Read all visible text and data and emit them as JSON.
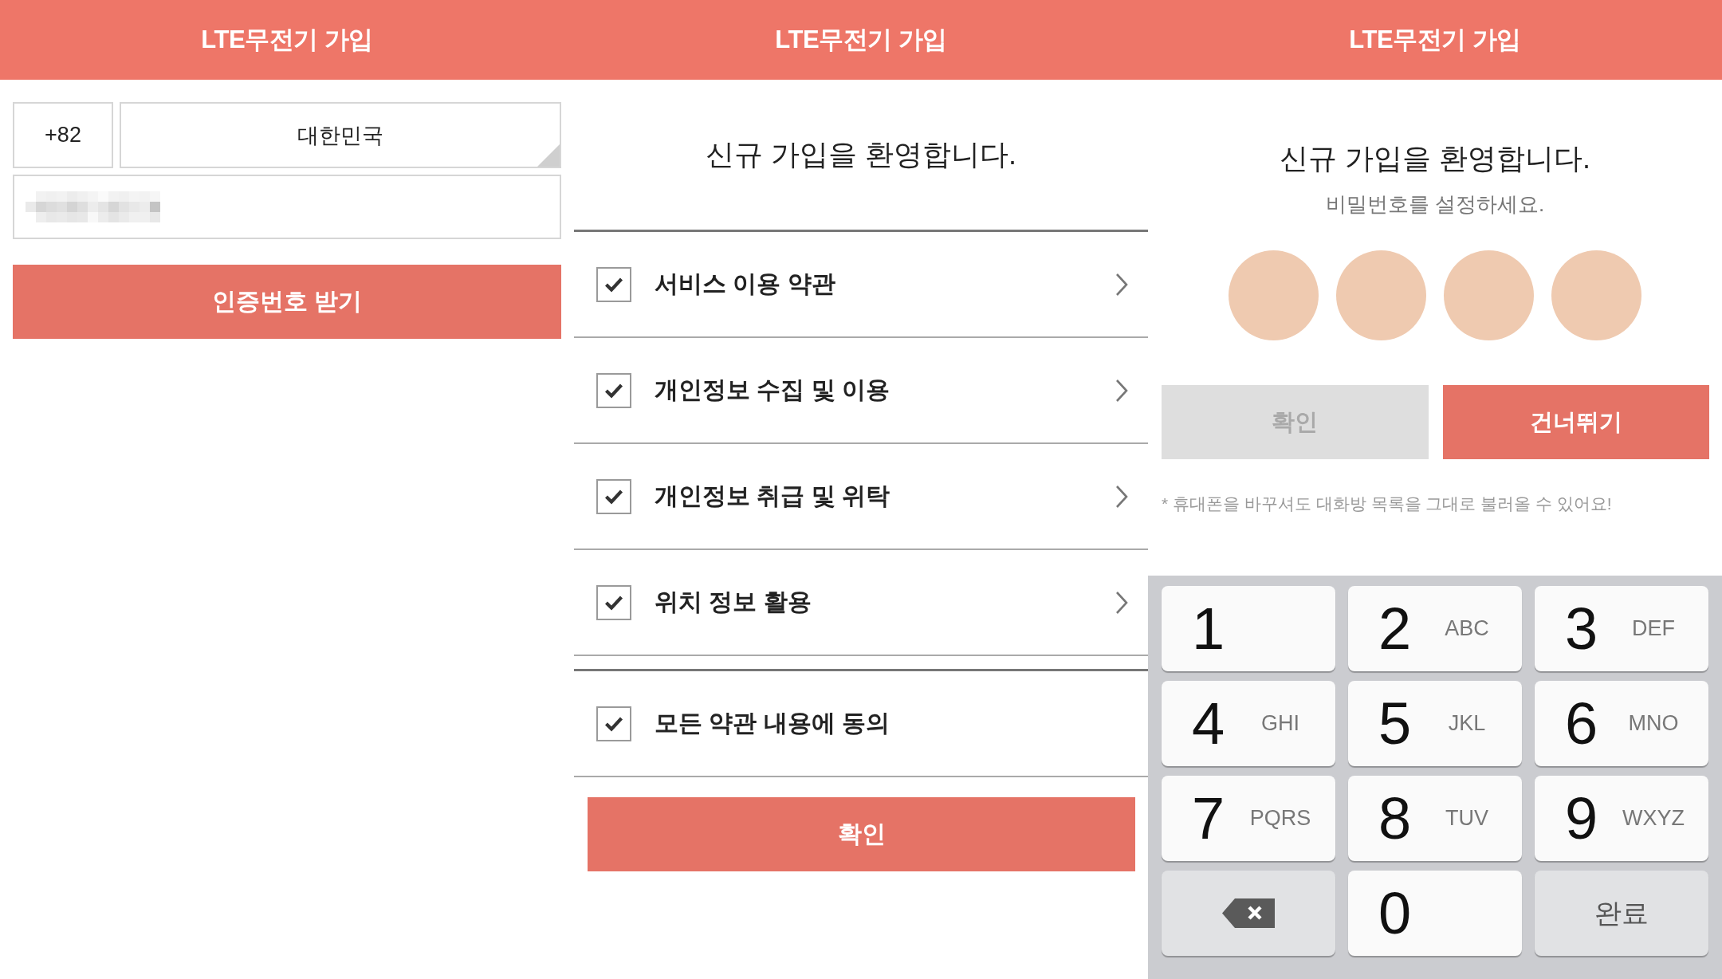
{
  "panels": [
    {
      "kind": "phone",
      "header": {
        "title": "LTE무전기 가입"
      },
      "country_code": "+82",
      "country": "대한민국",
      "phone_field": {
        "value_pixelated": true
      },
      "button": "인증번호 받기"
    },
    {
      "kind": "terms",
      "header": {
        "title": "LTE무전기 가입"
      },
      "welcome": "신규 가입을 환영합니다.",
      "terms": [
        {
          "label": "서비스 이용 약관",
          "checked": true
        },
        {
          "label": "개인정보 수집 및 이용",
          "checked": true
        },
        {
          "label": "개인정보 취급 및 위탁",
          "checked": true
        },
        {
          "label": "위치 정보 활용",
          "checked": true
        }
      ],
      "agree_all": {
        "label": "모든 약관 내용에 동의",
        "checked": true
      },
      "button": "확인"
    },
    {
      "kind": "password",
      "header": {
        "title": "LTE무전기 가입"
      },
      "welcome": "신규 가입을 환영합니다.",
      "subtitle": "비밀번호를 설정하세요.",
      "pin_dots": [
        {
          "filled": false
        },
        {
          "filled": false
        },
        {
          "filled": false
        },
        {
          "filled": false
        }
      ],
      "buttons": [
        {
          "label": "확인",
          "disabled": true
        },
        {
          "label": "건너뛰기",
          "disabled": false
        }
      ],
      "note": "* 휴대폰을 바꾸셔도 대화방 목록을 그대로 불러올 수 있어요!",
      "keypad": {
        "keys": [
          {
            "kind": "digit",
            "digit": "1"
          },
          {
            "kind": "digit",
            "digit": "2",
            "letters": "ABC"
          },
          {
            "kind": "digit",
            "digit": "3",
            "letters": "DEF"
          },
          {
            "kind": "digit",
            "digit": "4",
            "letters": "GHI"
          },
          {
            "kind": "digit",
            "digit": "5",
            "letters": "JKL"
          },
          {
            "kind": "digit",
            "digit": "6",
            "letters": "MNO"
          },
          {
            "kind": "digit",
            "digit": "7",
            "letters": "PQRS"
          },
          {
            "kind": "digit",
            "digit": "8",
            "letters": "TUV"
          },
          {
            "kind": "digit",
            "digit": "9",
            "letters": "WXYZ"
          },
          {
            "kind": "backspace"
          },
          {
            "kind": "digit",
            "digit": "0"
          },
          {
            "kind": "done",
            "label": "완료"
          }
        ]
      }
    }
  ]
}
